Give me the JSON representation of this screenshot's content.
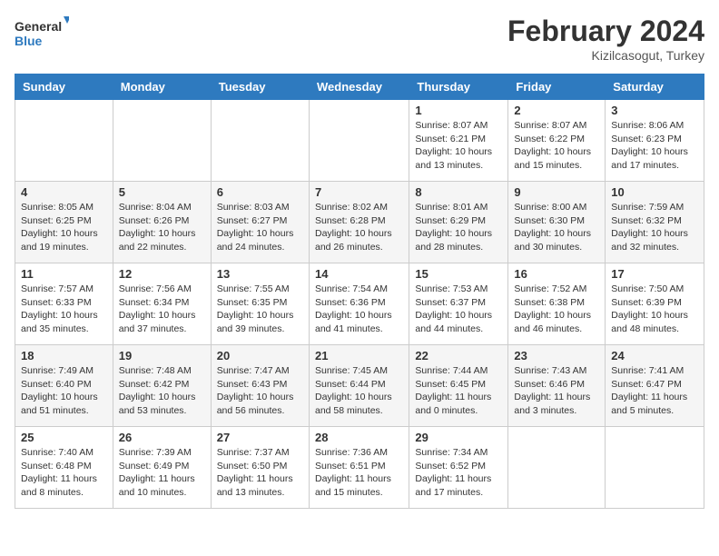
{
  "header": {
    "logo_general": "General",
    "logo_blue": "Blue",
    "month_title": "February 2024",
    "location": "Kizilcasogut, Turkey"
  },
  "days_of_week": [
    "Sunday",
    "Monday",
    "Tuesday",
    "Wednesday",
    "Thursday",
    "Friday",
    "Saturday"
  ],
  "weeks": [
    [
      {
        "day": "",
        "info": ""
      },
      {
        "day": "",
        "info": ""
      },
      {
        "day": "",
        "info": ""
      },
      {
        "day": "",
        "info": ""
      },
      {
        "day": "1",
        "info": "Sunrise: 8:07 AM\nSunset: 6:21 PM\nDaylight: 10 hours\nand 13 minutes."
      },
      {
        "day": "2",
        "info": "Sunrise: 8:07 AM\nSunset: 6:22 PM\nDaylight: 10 hours\nand 15 minutes."
      },
      {
        "day": "3",
        "info": "Sunrise: 8:06 AM\nSunset: 6:23 PM\nDaylight: 10 hours\nand 17 minutes."
      }
    ],
    [
      {
        "day": "4",
        "info": "Sunrise: 8:05 AM\nSunset: 6:25 PM\nDaylight: 10 hours\nand 19 minutes."
      },
      {
        "day": "5",
        "info": "Sunrise: 8:04 AM\nSunset: 6:26 PM\nDaylight: 10 hours\nand 22 minutes."
      },
      {
        "day": "6",
        "info": "Sunrise: 8:03 AM\nSunset: 6:27 PM\nDaylight: 10 hours\nand 24 minutes."
      },
      {
        "day": "7",
        "info": "Sunrise: 8:02 AM\nSunset: 6:28 PM\nDaylight: 10 hours\nand 26 minutes."
      },
      {
        "day": "8",
        "info": "Sunrise: 8:01 AM\nSunset: 6:29 PM\nDaylight: 10 hours\nand 28 minutes."
      },
      {
        "day": "9",
        "info": "Sunrise: 8:00 AM\nSunset: 6:30 PM\nDaylight: 10 hours\nand 30 minutes."
      },
      {
        "day": "10",
        "info": "Sunrise: 7:59 AM\nSunset: 6:32 PM\nDaylight: 10 hours\nand 32 minutes."
      }
    ],
    [
      {
        "day": "11",
        "info": "Sunrise: 7:57 AM\nSunset: 6:33 PM\nDaylight: 10 hours\nand 35 minutes."
      },
      {
        "day": "12",
        "info": "Sunrise: 7:56 AM\nSunset: 6:34 PM\nDaylight: 10 hours\nand 37 minutes."
      },
      {
        "day": "13",
        "info": "Sunrise: 7:55 AM\nSunset: 6:35 PM\nDaylight: 10 hours\nand 39 minutes."
      },
      {
        "day": "14",
        "info": "Sunrise: 7:54 AM\nSunset: 6:36 PM\nDaylight: 10 hours\nand 41 minutes."
      },
      {
        "day": "15",
        "info": "Sunrise: 7:53 AM\nSunset: 6:37 PM\nDaylight: 10 hours\nand 44 minutes."
      },
      {
        "day": "16",
        "info": "Sunrise: 7:52 AM\nSunset: 6:38 PM\nDaylight: 10 hours\nand 46 minutes."
      },
      {
        "day": "17",
        "info": "Sunrise: 7:50 AM\nSunset: 6:39 PM\nDaylight: 10 hours\nand 48 minutes."
      }
    ],
    [
      {
        "day": "18",
        "info": "Sunrise: 7:49 AM\nSunset: 6:40 PM\nDaylight: 10 hours\nand 51 minutes."
      },
      {
        "day": "19",
        "info": "Sunrise: 7:48 AM\nSunset: 6:42 PM\nDaylight: 10 hours\nand 53 minutes."
      },
      {
        "day": "20",
        "info": "Sunrise: 7:47 AM\nSunset: 6:43 PM\nDaylight: 10 hours\nand 56 minutes."
      },
      {
        "day": "21",
        "info": "Sunrise: 7:45 AM\nSunset: 6:44 PM\nDaylight: 10 hours\nand 58 minutes."
      },
      {
        "day": "22",
        "info": "Sunrise: 7:44 AM\nSunset: 6:45 PM\nDaylight: 11 hours\nand 0 minutes."
      },
      {
        "day": "23",
        "info": "Sunrise: 7:43 AM\nSunset: 6:46 PM\nDaylight: 11 hours\nand 3 minutes."
      },
      {
        "day": "24",
        "info": "Sunrise: 7:41 AM\nSunset: 6:47 PM\nDaylight: 11 hours\nand 5 minutes."
      }
    ],
    [
      {
        "day": "25",
        "info": "Sunrise: 7:40 AM\nSunset: 6:48 PM\nDaylight: 11 hours\nand 8 minutes."
      },
      {
        "day": "26",
        "info": "Sunrise: 7:39 AM\nSunset: 6:49 PM\nDaylight: 11 hours\nand 10 minutes."
      },
      {
        "day": "27",
        "info": "Sunrise: 7:37 AM\nSunset: 6:50 PM\nDaylight: 11 hours\nand 13 minutes."
      },
      {
        "day": "28",
        "info": "Sunrise: 7:36 AM\nSunset: 6:51 PM\nDaylight: 11 hours\nand 15 minutes."
      },
      {
        "day": "29",
        "info": "Sunrise: 7:34 AM\nSunset: 6:52 PM\nDaylight: 11 hours\nand 17 minutes."
      },
      {
        "day": "",
        "info": ""
      },
      {
        "day": "",
        "info": ""
      }
    ]
  ]
}
